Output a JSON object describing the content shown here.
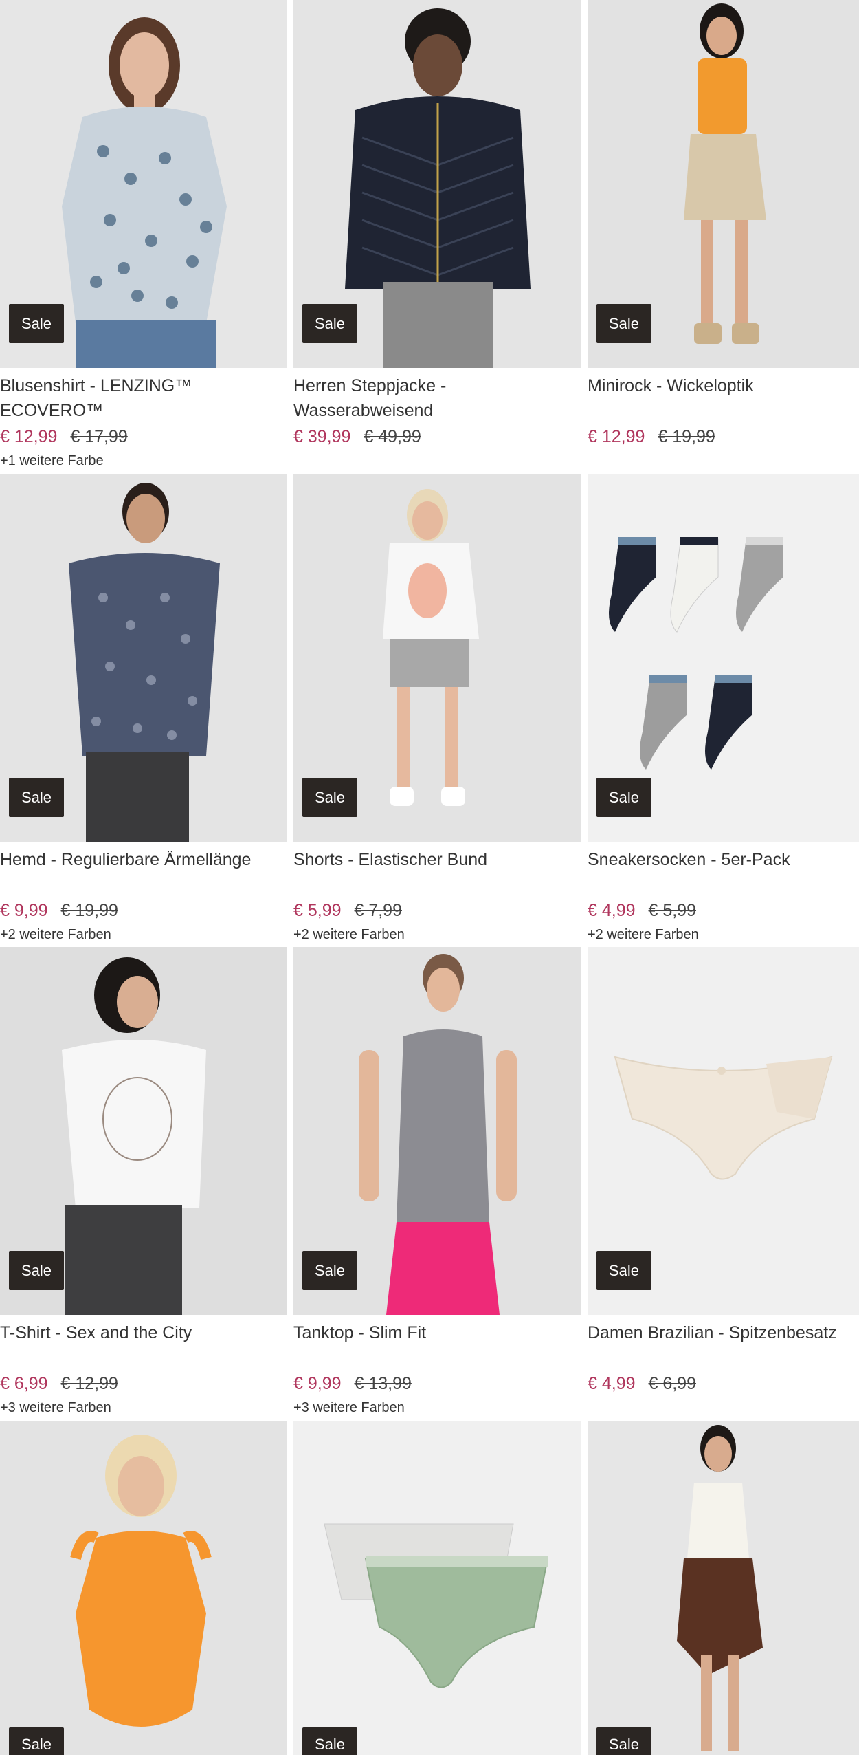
{
  "badge_label": "Sale",
  "colors": {
    "price_new": "#b0365d",
    "badge_bg": "#2b2623"
  },
  "products": [
    {
      "title": "Blusenshirt - LENZING™ ECOVERO™",
      "price": "€ 12,99",
      "old_price": "€ 17,99",
      "more_colors": "+1 weitere Farbe",
      "image": "woman-floral-blouse"
    },
    {
      "title": "Herren Steppjacke - Wasserabweisend",
      "price": "€ 39,99",
      "old_price": "€ 49,99",
      "more_colors": "",
      "image": "man-quilted-jacket"
    },
    {
      "title": "Minirock - Wickeloptik",
      "price": "€ 12,99",
      "old_price": "€ 19,99",
      "more_colors": "",
      "image": "woman-wrap-skirt"
    },
    {
      "title": "Hemd - Regulierbare Ärmellänge",
      "price": "€ 9,99",
      "old_price": "€ 19,99",
      "more_colors": "+2 weitere Farben",
      "image": "man-printed-shirt"
    },
    {
      "title": "Shorts - Elastischer Bund",
      "price": "€ 5,99",
      "old_price": "€ 7,99",
      "more_colors": "+2 weitere Farben",
      "image": "woman-shorts"
    },
    {
      "title": "Sneakersocken - 5er-Pack",
      "price": "€ 4,99",
      "old_price": "€ 5,99",
      "more_colors": "+2 weitere Farben",
      "image": "socks-pack"
    },
    {
      "title": "T-Shirt - Sex and the City",
      "price": "€ 6,99",
      "old_price": "€ 12,99",
      "more_colors": "+3 weitere Farben",
      "image": "woman-tshirt"
    },
    {
      "title": "Tanktop - Slim Fit",
      "price": "€ 9,99",
      "old_price": "€ 13,99",
      "more_colors": "+3 weitere Farben",
      "image": "woman-tanktop"
    },
    {
      "title": "Damen Brazilian - Spitzenbesatz",
      "price": "€ 4,99",
      "old_price": "€ 6,99",
      "more_colors": "",
      "image": "brazilian-brief"
    },
    {
      "title": "",
      "price": "",
      "old_price": "",
      "more_colors": "",
      "image": "woman-orange-body"
    },
    {
      "title": "",
      "price": "",
      "old_price": "",
      "more_colors": "",
      "image": "lace-briefs"
    },
    {
      "title": "",
      "price": "",
      "old_price": "",
      "more_colors": "",
      "image": "woman-brown-skirt"
    }
  ]
}
